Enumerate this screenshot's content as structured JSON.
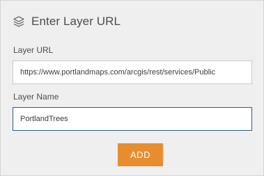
{
  "header": {
    "icon": "layers-icon",
    "title": "Enter Layer URL"
  },
  "layer_url": {
    "label": "Layer URL",
    "value": "https://www.portlandmaps.com/arcgis/rest/services/Public"
  },
  "layer_name": {
    "label": "Layer Name",
    "value": "PortlandTrees"
  },
  "actions": {
    "add_label": "ADD"
  },
  "colors": {
    "panel_background": "#efefef",
    "add_button": "#e88d2f",
    "focused_border": "#2b5c8a",
    "text": "#4c4c4c"
  }
}
